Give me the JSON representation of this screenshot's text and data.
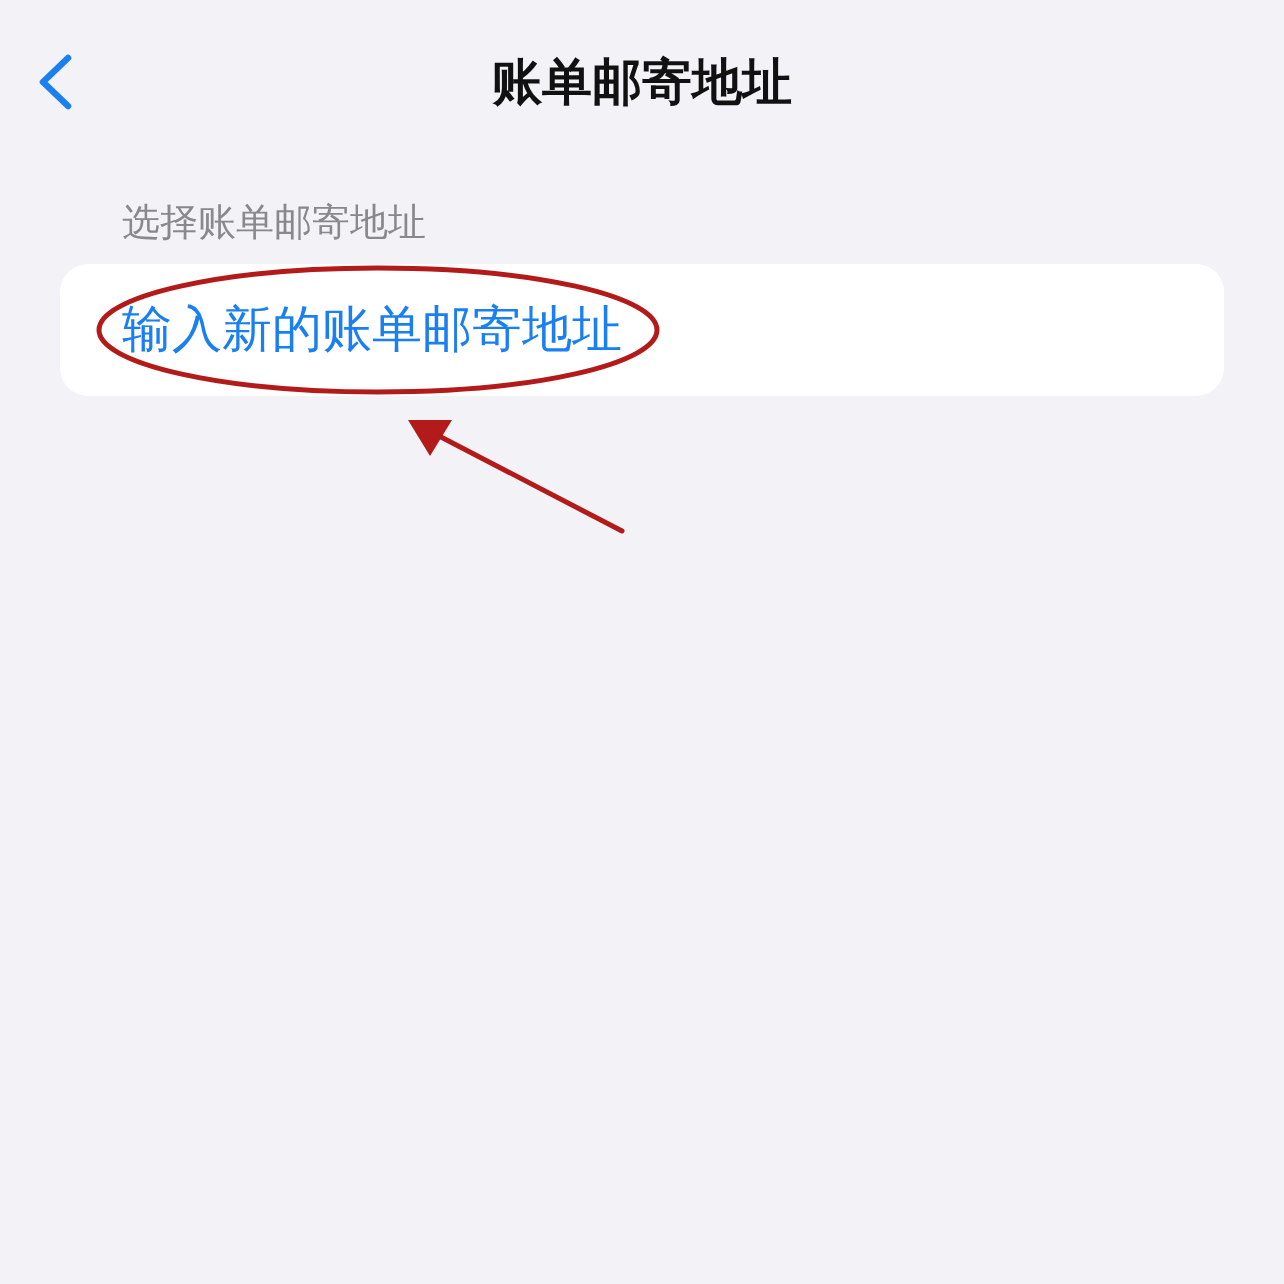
{
  "nav_bar": {
    "title": "账单邮寄地址"
  },
  "section": {
    "header": "选择账单邮寄地址",
    "items": [
      {
        "label": "输入新的账单邮寄地址",
        "kind": "link",
        "circled": true,
        "pointed_at": true
      }
    ]
  }
}
